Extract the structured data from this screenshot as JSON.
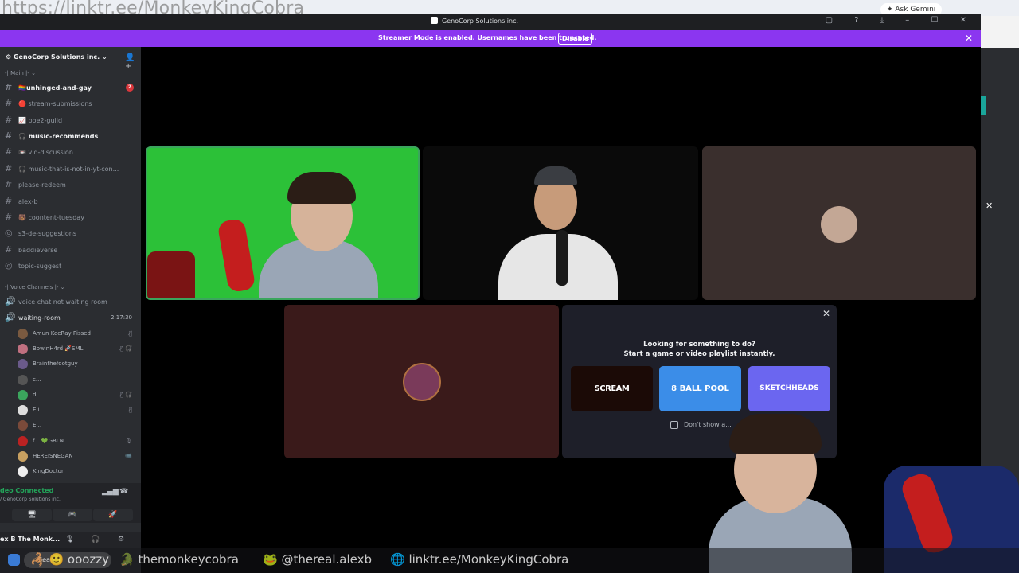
{
  "browser": {
    "url_overlay": "https://linktr.ee/MonkeyKingCobra",
    "ask_gemini": "✦ Ask Gemini"
  },
  "window": {
    "title": "GenoCorp Solutions inc.",
    "controls": "▢ ? ⤓ – ☐ ✕"
  },
  "banner": {
    "text": "Streamer Mode is enabled. Usernames have been truncated.",
    "disable_label": "Disable",
    "close": "✕",
    "color": "#8b36f0"
  },
  "sidebar": {
    "server_name": "GenoCorp Solutions inc. ⌄",
    "add_icon": "👤+",
    "main_category": "-| Main |- ⌄",
    "channels": [
      {
        "name": "🏳️‍🌈unhinged-and-gay",
        "bold": true,
        "badge": "2"
      },
      {
        "name": "🔴 stream-submissions",
        "bold": false
      },
      {
        "name": "📈 poe2-guild",
        "bold": false
      },
      {
        "name": "🎧 music-recommends",
        "bold": true
      },
      {
        "name": "📼 vid-discussion",
        "bold": false
      },
      {
        "name": "🎧 music-that-is-not-in-yt-con...",
        "bold": false
      },
      {
        "name": "please-redeem",
        "bold": false
      },
      {
        "name": "alex-b",
        "bold": false
      },
      {
        "name": "🐻 coontent-tuesday",
        "bold": false
      },
      {
        "name": "s3-de-suggestions",
        "bold": false
      },
      {
        "name": "baddieverse",
        "bold": false
      },
      {
        "name": "topic-suggest",
        "bold": false
      }
    ],
    "voice_category": "-| Voice Channels |- ⌄",
    "voice_channels": [
      {
        "name": "voice chat not waiting room"
      },
      {
        "name": "waiting-room",
        "time": "2:17:30"
      }
    ],
    "users": [
      {
        "name": "Amun KeeRay Pissed",
        "icons": "🎙̸"
      },
      {
        "name": "BowinH4rd 🚀SML",
        "icons": "🎙̸ 🎧̸"
      },
      {
        "name": "Brainthefootguy",
        "icons": ""
      },
      {
        "name": "c...",
        "icons": ""
      },
      {
        "name": "d...",
        "icons": "🎙̸ 🎧̸"
      },
      {
        "name": "Eli",
        "icons": "🎙̸"
      },
      {
        "name": "E...",
        "icons": ""
      },
      {
        "name": "f... 💚GBLN",
        "icons": "🎙"
      },
      {
        "name": "HEREISNEGAN",
        "icons": "📹"
      },
      {
        "name": "KingDoctor",
        "icons": ""
      }
    ],
    "voice_panel": {
      "status": "deo Connected",
      "sub": "/ GenoCorp Solutions inc.",
      "btn_icons": [
        "🖥",
        "🎮",
        "🚀"
      ]
    },
    "user_bar": {
      "name": "ex B The Monk...",
      "icons": [
        "🎙",
        "🎧",
        "⚙"
      ]
    }
  },
  "activity_panel": {
    "title": "Looking for something to do?",
    "subtitle": "Start a game or video playlist instantly.",
    "games": [
      "SCREAM",
      "8 BALL POOL",
      "SKETCHHEADS"
    ],
    "checkbox_label": "Don't show a...",
    "close": "✕"
  },
  "popup_close": "✕",
  "taskbar": {
    "search_label": "Search",
    "overlay_texts": [
      "🦂 🙂 ooozzy",
      "🐊 themonkeycobra",
      "🐸 @thereal.alexb",
      "🌐 linktr.ee/MonkeyKingCobra"
    ]
  }
}
